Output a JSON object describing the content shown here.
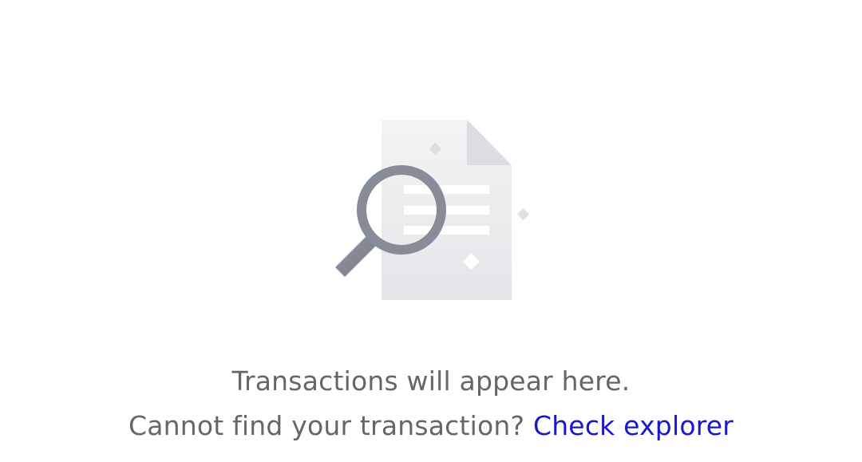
{
  "empty_state": {
    "illustration_icon": "document-search-icon",
    "headline": "Transactions will appear here.",
    "prompt_text": "Cannot find your transaction?",
    "link_label": "Check explorer"
  },
  "colors": {
    "text": "#666666",
    "link": "#1a17c8",
    "document": "#e9eaec",
    "magnifier": "#858b95"
  }
}
